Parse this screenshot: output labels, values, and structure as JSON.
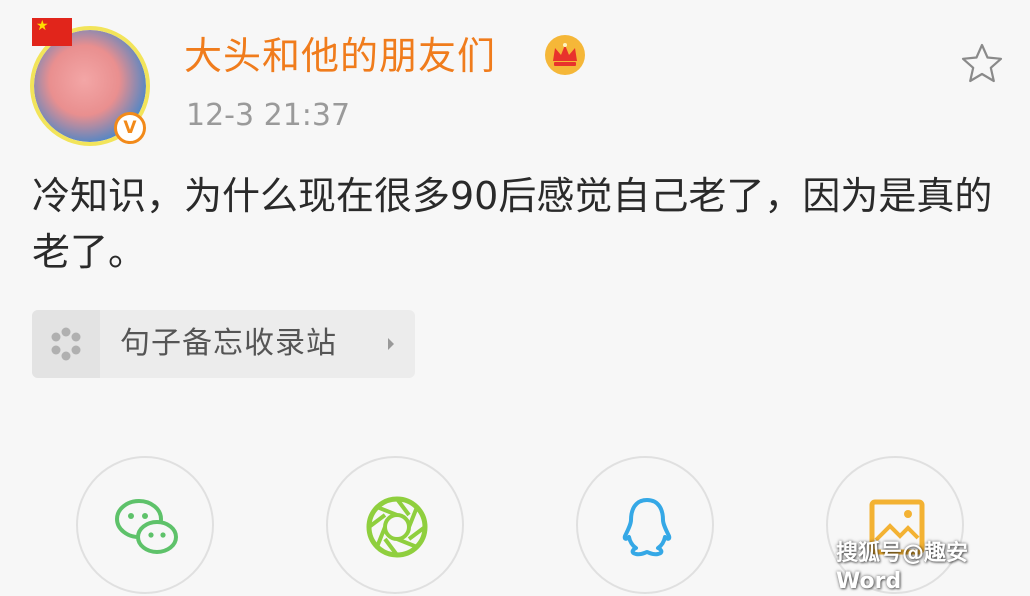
{
  "post": {
    "username": "大头和他的朋友们",
    "timestamp": "12-3 21:37",
    "text": "冷知识，为什么现在很多90后感觉自己老了，因为是真的老了。",
    "verified_badge": "V"
  },
  "topic": {
    "label": "句子备忘收录站"
  },
  "share": {
    "items": [
      "wechat-icon",
      "moments-icon",
      "qq-icon",
      "qzone-icon"
    ]
  },
  "watermark": "搜狐号@趣安Word",
  "colors": {
    "username": "#f07c1c",
    "wechat": "#5ec26a",
    "moments": "#8fcf3e",
    "qq": "#35a8e6",
    "qzone": "#f3b233"
  }
}
